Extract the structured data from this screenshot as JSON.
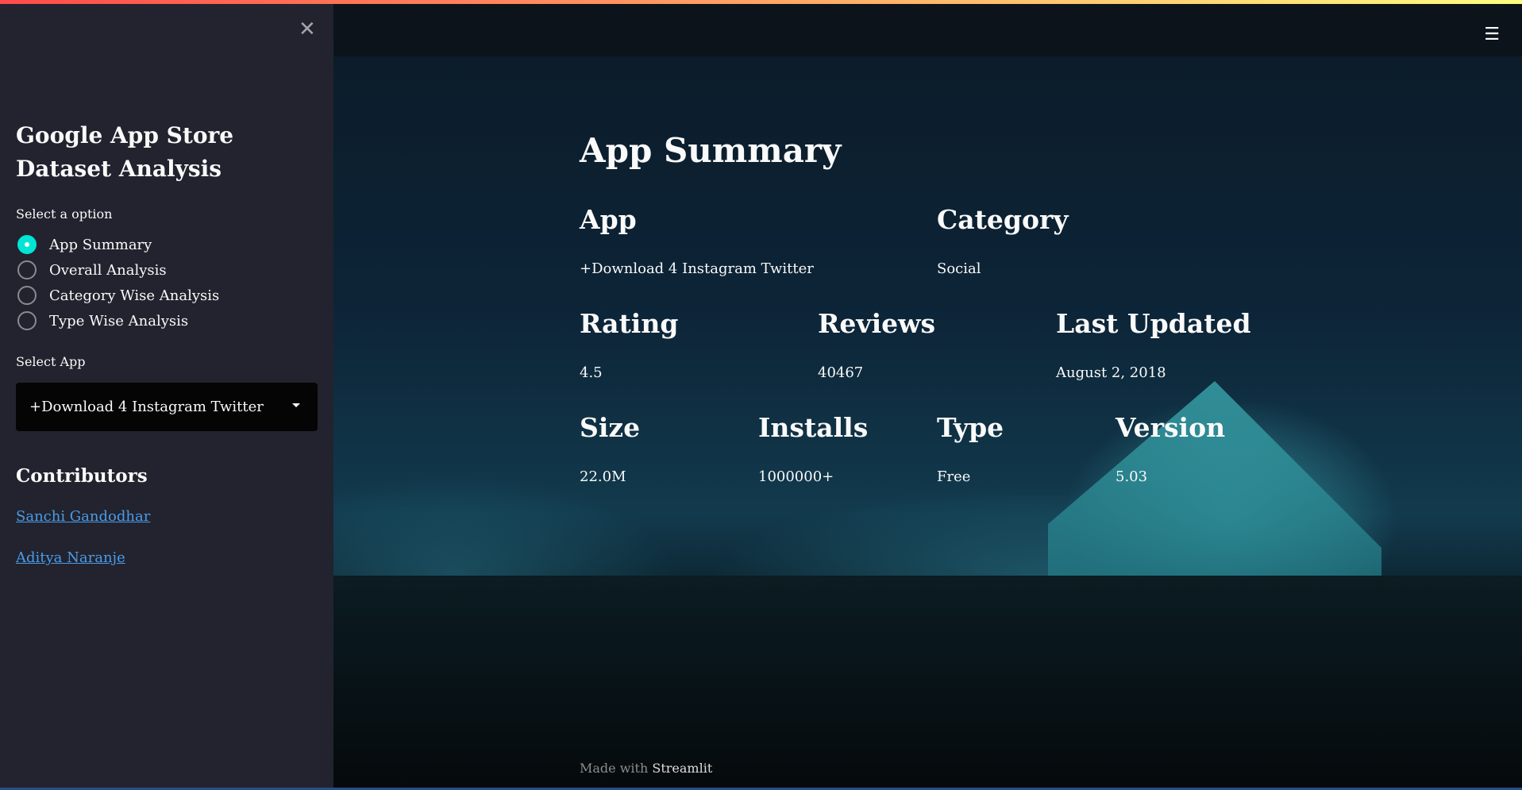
{
  "sidebar": {
    "title": "Google App Store Dataset Analysis",
    "option_label": "Select a option",
    "options": [
      "App Summary",
      "Overall Analysis",
      "Category Wise Analysis",
      "Type Wise Analysis"
    ],
    "selected_option": "App Summary",
    "select_app_label": "Select App",
    "selected_app": "+Download 4 Instagram Twitter",
    "contributors_title": "Contributors",
    "contributors": [
      "Sanchi Gandodhar",
      "Aditya Naranje"
    ]
  },
  "main": {
    "title": "App Summary",
    "fields": {
      "app": {
        "label": "App",
        "value": "+Download 4 Instagram Twitter"
      },
      "category": {
        "label": "Category",
        "value": "Social"
      },
      "rating": {
        "label": "Rating",
        "value": "4.5"
      },
      "reviews": {
        "label": "Reviews",
        "value": "40467"
      },
      "last_updated": {
        "label": "Last Updated",
        "value": "August 2, 2018"
      },
      "size": {
        "label": "Size",
        "value": "22.0M"
      },
      "installs": {
        "label": "Installs",
        "value": "1000000+"
      },
      "type": {
        "label": "Type",
        "value": "Free"
      },
      "version": {
        "label": "Version",
        "value": "5.03"
      }
    }
  },
  "footer": {
    "made_with": "Made with",
    "brand": "Streamlit"
  },
  "colors": {
    "accent": "#00e5d4",
    "link": "#4a9be8"
  }
}
